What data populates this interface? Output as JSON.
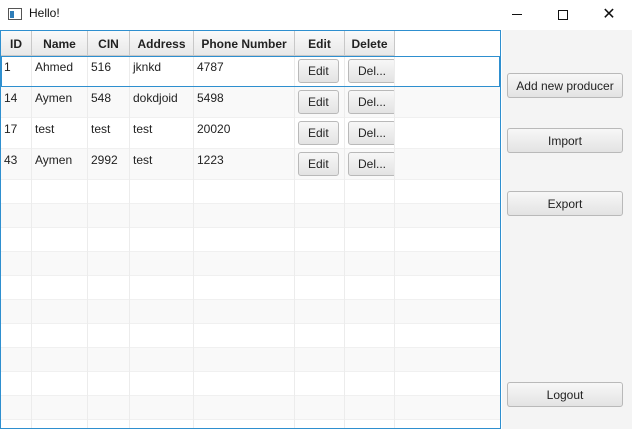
{
  "window": {
    "title": "Hello!"
  },
  "table": {
    "columns": [
      "ID",
      "Name",
      "CIN",
      "Address",
      "Phone Number",
      "Edit",
      "Delete"
    ],
    "rows": [
      {
        "id": "1",
        "name": "Ahmed",
        "cin": "516",
        "address": "jknkd",
        "phone": "4787",
        "edit": "Edit",
        "delete": "Del..."
      },
      {
        "id": "14",
        "name": "Aymen",
        "cin": "548",
        "address": "dokdjoid",
        "phone": "5498",
        "edit": "Edit",
        "delete": "Del..."
      },
      {
        "id": "17",
        "name": "test",
        "cin": "test",
        "address": "test",
        "phone": "20020",
        "edit": "Edit",
        "delete": "Del..."
      },
      {
        "id": "43",
        "name": "Aymen",
        "cin": "2992",
        "address": "test",
        "phone": "1223",
        "edit": "Edit",
        "delete": "Del..."
      }
    ]
  },
  "side_buttons": {
    "add": "Add new producer",
    "import": "Import",
    "export": "Export",
    "logout": "Logout"
  },
  "colors": {
    "selection_border": "#2e8fcf"
  }
}
